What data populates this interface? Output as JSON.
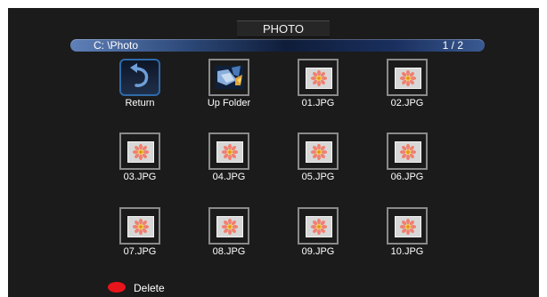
{
  "header": {
    "title": "PHOTO"
  },
  "path_bar": {
    "path": "C: \\Photo",
    "page": "1 / 2"
  },
  "grid": {
    "items": [
      {
        "label": "Return",
        "icon": "return-arrow-icon"
      },
      {
        "label": "Up Folder",
        "icon": "up-folder-icon"
      },
      {
        "label": "01.JPG",
        "icon": "photo-thumbnail-icon"
      },
      {
        "label": "02.JPG",
        "icon": "photo-thumbnail-icon"
      },
      {
        "label": "03.JPG",
        "icon": "photo-thumbnail-icon"
      },
      {
        "label": "04.JPG",
        "icon": "photo-thumbnail-icon"
      },
      {
        "label": "05.JPG",
        "icon": "photo-thumbnail-icon"
      },
      {
        "label": "06.JPG",
        "icon": "photo-thumbnail-icon"
      },
      {
        "label": "07.JPG",
        "icon": "photo-thumbnail-icon"
      },
      {
        "label": "08.JPG",
        "icon": "photo-thumbnail-icon"
      },
      {
        "label": "09.JPG",
        "icon": "photo-thumbnail-icon"
      },
      {
        "label": "10.JPG",
        "icon": "photo-thumbnail-icon"
      }
    ]
  },
  "footer": {
    "delete_label": "Delete",
    "delete_color": "#e8141b"
  },
  "colors": {
    "background": "#1b1b1b",
    "selection_border": "#2f6aa8",
    "thumbnail_border": "#8a8a8a"
  }
}
